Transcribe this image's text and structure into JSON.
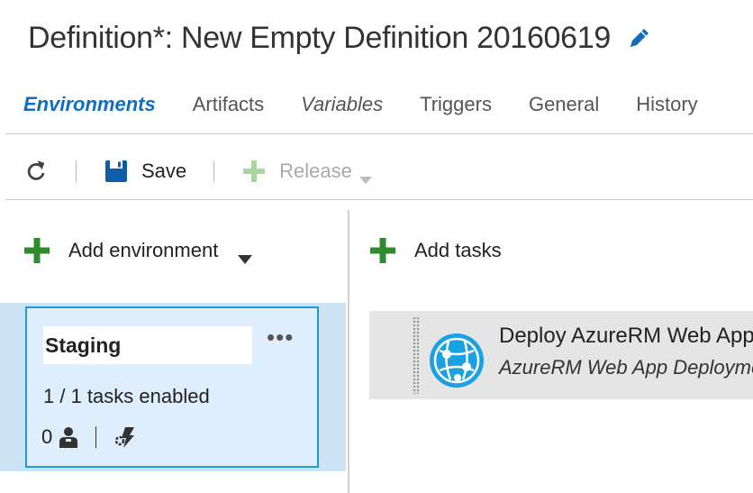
{
  "header": {
    "title": "Definition*: New Empty Definition 20160619",
    "edit_icon": "pencil-icon"
  },
  "tabs": [
    {
      "label": "Environments",
      "active": true
    },
    {
      "label": "Artifacts"
    },
    {
      "label": "Variables"
    },
    {
      "label": "Triggers"
    },
    {
      "label": "General"
    },
    {
      "label": "History"
    }
  ],
  "toolbar": {
    "refresh_icon": "refresh-icon",
    "save_label": "Save",
    "release_label": "Release"
  },
  "left": {
    "add_environment_label": "Add environment",
    "environment": {
      "name": "Staging",
      "more": "•••",
      "tasks_enabled": "1 / 1 tasks enabled",
      "approvers_count": "0"
    }
  },
  "right": {
    "add_tasks_label": "Add tasks",
    "task": {
      "title": "Deploy AzureRM Web App",
      "subtitle": "AzureRM Web App Deployment"
    }
  },
  "colors": {
    "accent": "#106ebe",
    "plus_green": "#2e8b2e",
    "selected_bg": "#cde4f7",
    "card_border": "#1e9ad6",
    "azure_icon": "#1ba1e2"
  }
}
